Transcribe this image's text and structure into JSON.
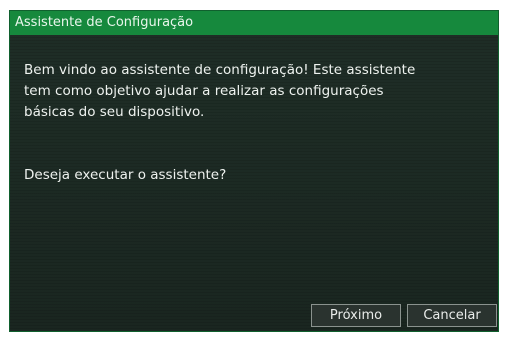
{
  "dialog": {
    "title": "Assistente de Configuração",
    "message_lines": [
      "Bem vindo ao assistente de configuração! Este assistente",
      "tem como objetivo ajudar a realizar as configurações",
      "básicas do seu dispositivo."
    ],
    "question": "Deseja executar o assistente?",
    "buttons": {
      "next_label": "Próximo",
      "cancel_label": "Cancelar"
    }
  },
  "colors": {
    "title_bar": "#16893d",
    "background": "#1c2a24",
    "text": "#eef2ef"
  }
}
